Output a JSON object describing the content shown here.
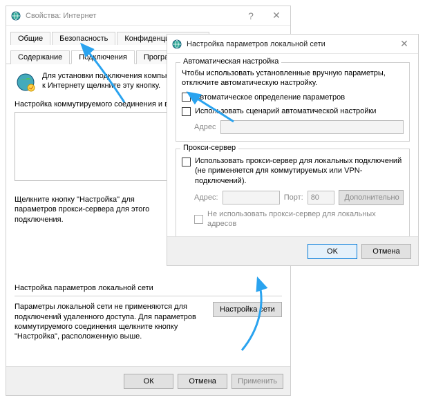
{
  "back": {
    "title": "Свойства: Интернет",
    "tabs_row1": [
      "Общие",
      "Безопасность",
      "Конфиденциальность"
    ],
    "tabs_row2": [
      "Содержание",
      "Подключения",
      "Программы"
    ],
    "active_tab": "Подключения",
    "install_text_line1": "Для установки подключения компьютера",
    "install_text_line2": "к Интернету щелкните эту кнопку.",
    "dialup_label": "Настройка коммутируемого соединения и виртуальных частных сетей",
    "proxy_hint": "Щелкните кнопку \"Настройка\" для параметров прокси-сервера для этого подключения.",
    "lan_section_title": "Настройка параметров локальной сети",
    "lan_section_text": "Параметры локальной сети не применяются для подключений удаленного доступа. Для параметров коммутируемого соединения щелкните кнопку \"Настройка\", расположенную выше.",
    "lan_button": "Настройка сети",
    "footer": {
      "ok": "ОК",
      "cancel": "Отмена",
      "apply": "Применить"
    }
  },
  "front": {
    "title": "Настройка параметров локальной сети",
    "auto": {
      "legend": "Автоматическая настройка",
      "desc": "Чтобы использовать установленные вручную параметры, отключите автоматическую настройку.",
      "detect": "Автоматическое определение параметров",
      "script": "Использовать сценарий автоматической настройки",
      "addr_label": "Адрес"
    },
    "proxy": {
      "legend": "Прокси-сервер",
      "use": "Использовать прокси-сервер для локальных подключений (не применяется для коммутируемых или VPN-подключений).",
      "addr_label": "Адрес:",
      "port_label": "Порт:",
      "port_value": "80",
      "advanced": "Дополнительно",
      "bypass": "Не использовать прокси-сервер для локальных адресов"
    },
    "footer": {
      "ok": "OK",
      "cancel": "Отмена"
    }
  }
}
